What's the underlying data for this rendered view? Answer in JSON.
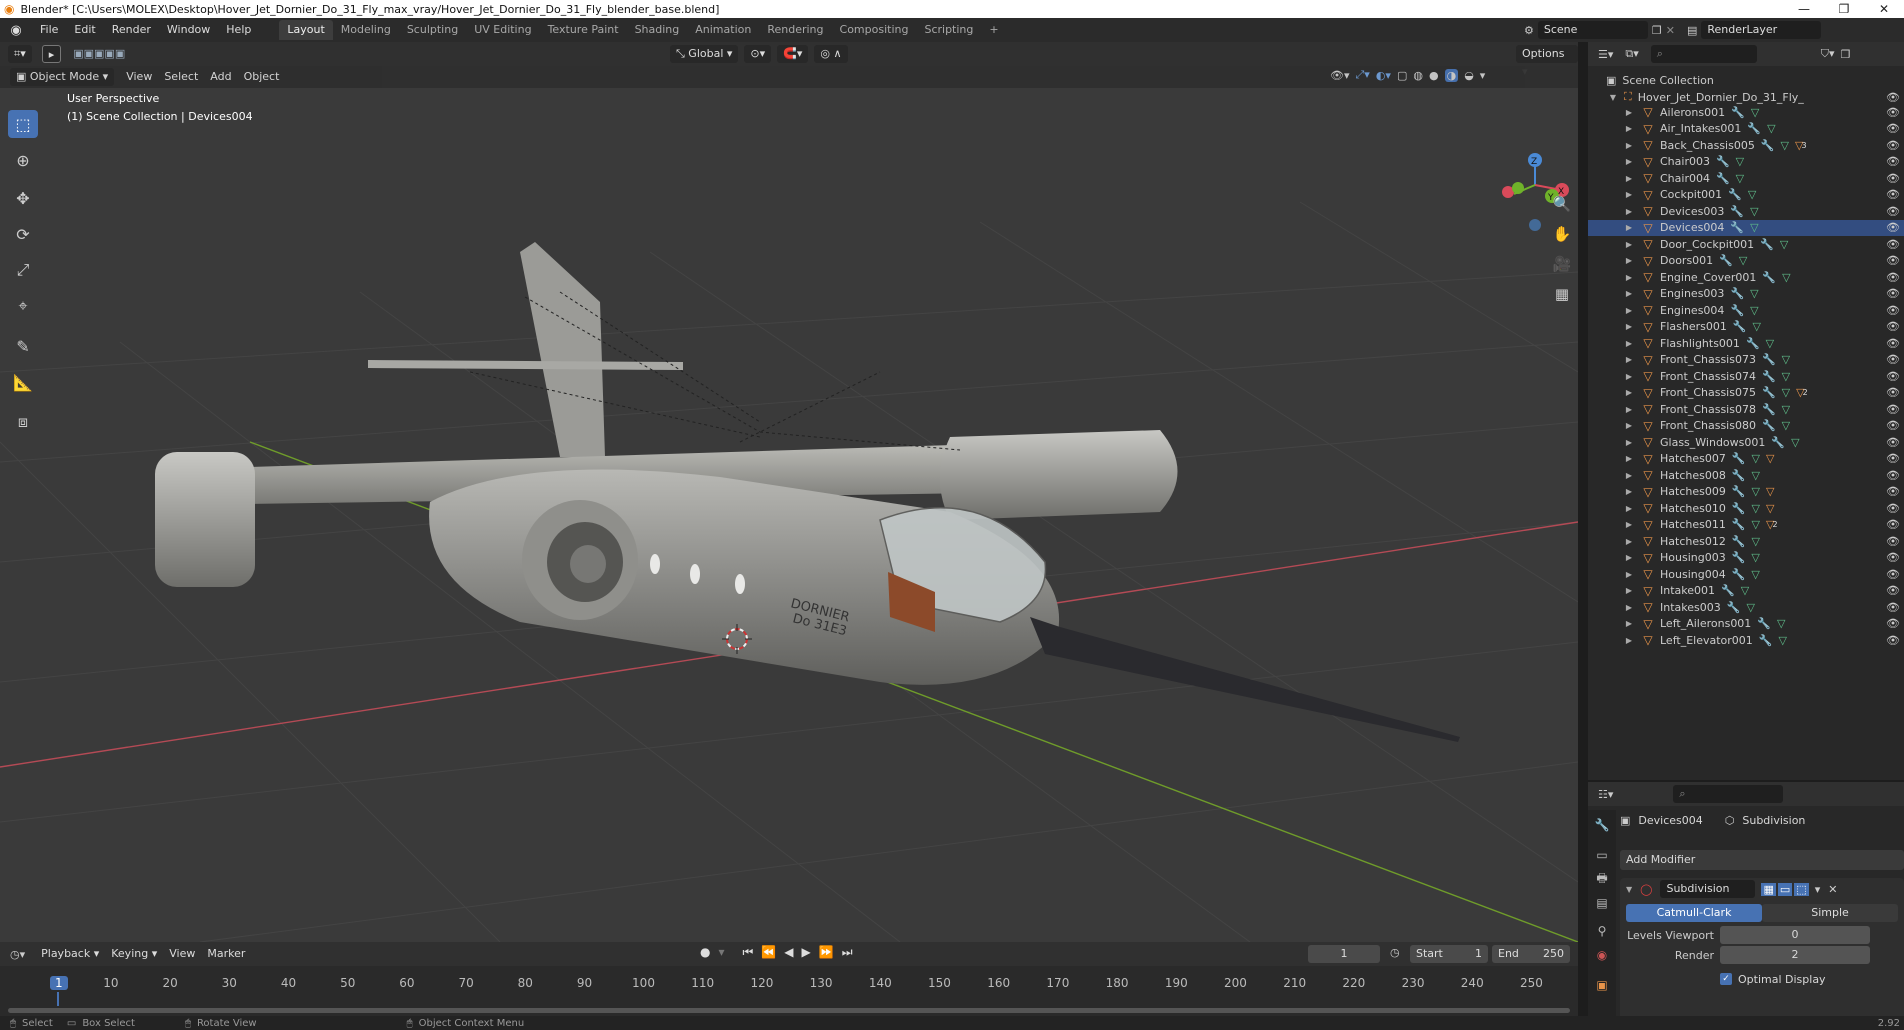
{
  "window": {
    "title": "Blender* [C:\\Users\\MOLEX\\Desktop\\Hover_Jet_Dornier_Do_31_Fly_max_vray/Hover_Jet_Dornier_Do_31_Fly_blender_base.blend]"
  },
  "menus": [
    "File",
    "Edit",
    "Render",
    "Window",
    "Help"
  ],
  "workspaces": [
    "Layout",
    "Modeling",
    "Sculpting",
    "UV Editing",
    "Texture Paint",
    "Shading",
    "Animation",
    "Rendering",
    "Compositing",
    "Scripting"
  ],
  "scene": {
    "name": "Scene",
    "view_layer": "RenderLayer"
  },
  "viewport": {
    "transform_orientation": "Global",
    "options_label": "Options",
    "mode": "Object Mode",
    "menus": [
      "View",
      "Select",
      "Add",
      "Object"
    ],
    "overlay_title": "User Perspective",
    "overlay_subtitle": "(1) Scene Collection | Devices004",
    "model_text_line1": "DORNIER",
    "model_text_line2": "Do 31E3",
    "gizmo": {
      "z": "Z",
      "y": "Y",
      "x": "X"
    }
  },
  "outliner": {
    "root": "Scene Collection",
    "collection": "Hover_Jet_Dornier_Do_31_Fly_",
    "selected": "Devices004",
    "items": [
      {
        "name": "Ailerons001",
        "mat": false
      },
      {
        "name": "Air_Intakes001",
        "mat": false
      },
      {
        "name": "Back_Chassis005",
        "mat": true,
        "count": "3"
      },
      {
        "name": "Chair003",
        "mat": false
      },
      {
        "name": "Chair004",
        "mat": false
      },
      {
        "name": "Cockpit001",
        "mat": false
      },
      {
        "name": "Devices003",
        "mat": false
      },
      {
        "name": "Devices004",
        "mat": false
      },
      {
        "name": "Door_Cockpit001",
        "mat": false
      },
      {
        "name": "Doors001",
        "mat": false
      },
      {
        "name": "Engine_Cover001",
        "mat": false
      },
      {
        "name": "Engines003",
        "mat": false
      },
      {
        "name": "Engines004",
        "mat": false
      },
      {
        "name": "Flashers001",
        "mat": false
      },
      {
        "name": "Flashlights001",
        "mat": false
      },
      {
        "name": "Front_Chassis073",
        "mat": false
      },
      {
        "name": "Front_Chassis074",
        "mat": false
      },
      {
        "name": "Front_Chassis075",
        "mat": true,
        "count": "2"
      },
      {
        "name": "Front_Chassis078",
        "mat": false
      },
      {
        "name": "Front_Chassis080",
        "mat": false
      },
      {
        "name": "Glass_Windows001",
        "mat": false
      },
      {
        "name": "Hatches007",
        "mat": true
      },
      {
        "name": "Hatches008",
        "mat": false
      },
      {
        "name": "Hatches009",
        "mat": true
      },
      {
        "name": "Hatches010",
        "mat": true
      },
      {
        "name": "Hatches011",
        "mat": true,
        "count": "2"
      },
      {
        "name": "Hatches012",
        "mat": false
      },
      {
        "name": "Housing003",
        "mat": false
      },
      {
        "name": "Housing004",
        "mat": false
      },
      {
        "name": "Intake001",
        "mat": false
      },
      {
        "name": "Intakes003",
        "mat": false
      },
      {
        "name": "Left_Ailerons001",
        "mat": false
      },
      {
        "name": "Left_Elevator001",
        "mat": false
      }
    ]
  },
  "properties": {
    "object": "Devices004",
    "modifier_tab": "Subdivision",
    "add_modifier": "Add Modifier",
    "modifier_name": "Subdivision",
    "algo_a": "Catmull-Clark",
    "algo_b": "Simple",
    "levels_label": "Levels Viewport",
    "levels_value": "0",
    "render_label": "Render",
    "render_value": "2",
    "optimal_label": "Optimal Display",
    "optimal_checked": true
  },
  "timeline": {
    "menus": [
      "Playback",
      "Keying",
      "View",
      "Marker"
    ],
    "current_frame": "1",
    "start_label": "Start",
    "start_value": "1",
    "end_label": "End",
    "end_value": "250",
    "ticks": [
      "1",
      "10",
      "20",
      "30",
      "40",
      "50",
      "60",
      "70",
      "80",
      "90",
      "100",
      "110",
      "120",
      "130",
      "140",
      "150",
      "160",
      "170",
      "180",
      "190",
      "200",
      "210",
      "220",
      "230",
      "240",
      "250"
    ]
  },
  "status": {
    "items": [
      "Select",
      "Box Select",
      "Rotate View",
      "Object Context Menu"
    ],
    "version": "2.92"
  },
  "colors": {
    "accent": "#4772b3",
    "selected_row": "#334d80",
    "mesh": "#e8944a",
    "modifier": "#6f9ed8",
    "mesh_data": "#5fbd8a"
  }
}
